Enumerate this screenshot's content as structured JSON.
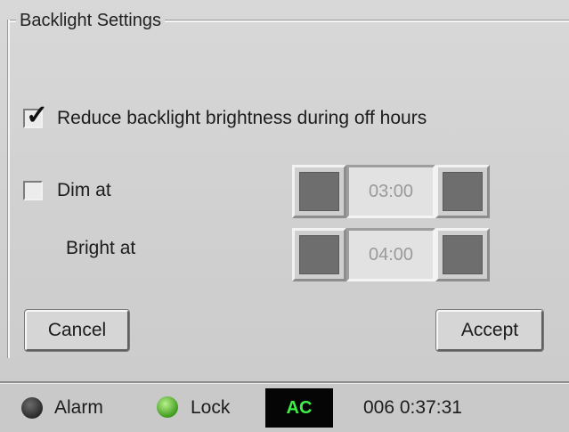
{
  "dialog": {
    "title": "Backlight Settings",
    "reduce_checkbox": {
      "checked": true,
      "label": "Reduce backlight brightness during off hours"
    },
    "dim": {
      "checked": false,
      "label": "Dim at",
      "time": "03:00"
    },
    "bright": {
      "label": "Bright at",
      "time": "04:00"
    },
    "cancel_label": "Cancel",
    "accept_label": "Accept"
  },
  "statusbar": {
    "alarm_label": "Alarm",
    "lock_label": "Lock",
    "power_label": "AC",
    "clock": "006 0:37:31"
  },
  "colors": {
    "background": "#d2d2d2",
    "alarm_led": "#2a2a2a",
    "lock_led": "#3f9b1f",
    "ac_text": "#3df046",
    "ac_background": "#050505"
  },
  "icons": {
    "checkmark": "checkmark-icon",
    "alarm": "alarm-led-icon",
    "lock": "lock-led-icon"
  }
}
